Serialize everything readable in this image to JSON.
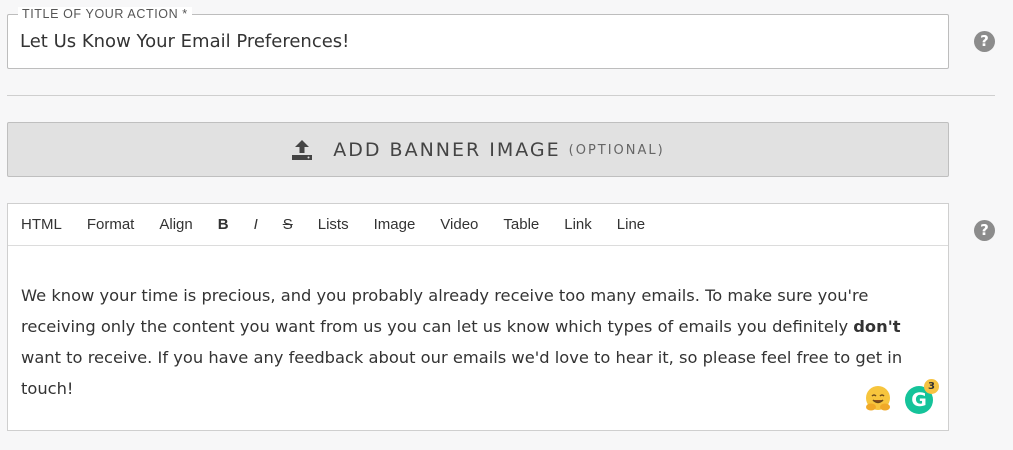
{
  "title_field": {
    "legend": "TITLE OF YOUR ACTION *",
    "value": "Let Us Know Your Email Preferences!"
  },
  "help_icon_glyph": "?",
  "banner": {
    "label": "ADD BANNER IMAGE",
    "optional": "(OPTIONAL)",
    "icon": "upload-icon"
  },
  "editor": {
    "toolbar": {
      "html": "HTML",
      "format": "Format",
      "align": "Align",
      "bold": "B",
      "italic": "I",
      "strike": "S",
      "lists": "Lists",
      "image": "Image",
      "video": "Video",
      "table": "Table",
      "link": "Link",
      "line": "Line"
    },
    "content": {
      "part1": "We know your time is precious, and you probably already receive too many emails. To make sure you're receiving only the content you want from us you can let us know which types of emails you definitely ",
      "bold": "don't",
      "part2": " want to receive. If you have any feedback about our emails we'd love to hear it, so please feel free to get in touch!"
    },
    "grammarly": {
      "letter": "G",
      "count": "3",
      "color": "#15c39a"
    },
    "emoji_icon": "hugging-face-icon"
  }
}
